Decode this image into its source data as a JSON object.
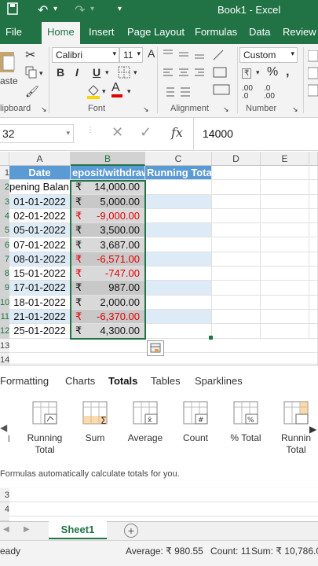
{
  "window": {
    "title": "Book1 - Excel"
  },
  "tabs": [
    "File",
    "Home",
    "Insert",
    "Page Layout",
    "Formulas",
    "Data",
    "Review"
  ],
  "ribbon": {
    "clipboard": {
      "paste_label": "aste",
      "group_label": "lipboard"
    },
    "font": {
      "name": "Calibri",
      "size": "11",
      "bold": "B",
      "italic": "I",
      "underline": "U",
      "grow": "A",
      "shrink": "A",
      "group_label": "Font"
    },
    "alignment": {
      "group_label": "Alignment"
    },
    "number": {
      "format": "Custom",
      "currency": "₹",
      "percent": "%",
      "comma": ",",
      "inc_dec": ".00\n.0",
      "dec_dec": ".0\n.00",
      "group_label": "Number"
    }
  },
  "formula_bar": {
    "name_box": "32",
    "fx": "fx",
    "value": "14000"
  },
  "columns": [
    "A",
    "B",
    "C",
    "D",
    "E"
  ],
  "row_numbers": [
    "1",
    "2",
    "3",
    "4",
    "5",
    "6",
    "7",
    "8",
    "9",
    "10",
    "11",
    "12",
    "13",
    "14"
  ],
  "table": {
    "headers": [
      "Date",
      "eposit/withdraw",
      "Running Total"
    ],
    "rows": [
      {
        "date": "pening Balan",
        "currency": "₹",
        "amount": "14,000.00",
        "negative": false
      },
      {
        "date": "01-01-2022",
        "currency": "₹",
        "amount": "5,000.00",
        "negative": false
      },
      {
        "date": "02-01-2022",
        "currency": "₹",
        "amount": "-9,000.00",
        "negative": true
      },
      {
        "date": "05-01-2022",
        "currency": "₹",
        "amount": "3,500.00",
        "negative": false
      },
      {
        "date": "07-01-2022",
        "currency": "₹",
        "amount": "3,687.00",
        "negative": false
      },
      {
        "date": "08-01-2022",
        "currency": "₹",
        "amount": "-6,571.00",
        "negative": true
      },
      {
        "date": "15-01-2022",
        "currency": "₹",
        "amount": "-747.00",
        "negative": true
      },
      {
        "date": "17-01-2022",
        "currency": "₹",
        "amount": "987.00",
        "negative": false
      },
      {
        "date": "18-01-2022",
        "currency": "₹",
        "amount": "2,000.00",
        "negative": false
      },
      {
        "date": "21-01-2022",
        "currency": "₹",
        "amount": "-6,370.00",
        "negative": true
      },
      {
        "date": "25-01-2022",
        "currency": "₹",
        "amount": "4,300.00",
        "negative": false
      }
    ]
  },
  "quick_analysis": {
    "tabs": [
      "Formatting",
      "Charts",
      "Totals",
      "Tables",
      "Sparklines"
    ],
    "active_tab": "Totals",
    "items": [
      {
        "label": "Running\nTotal",
        "icon": "running-total-column-icon"
      },
      {
        "label": "Sum",
        "icon": "sum-icon"
      },
      {
        "label": "Average",
        "icon": "average-icon"
      },
      {
        "label": "Count",
        "icon": "count-icon"
      },
      {
        "label": "% Total",
        "icon": "percent-total-icon"
      },
      {
        "label": "Runnin\nTotal",
        "icon": "running-total-row-icon"
      }
    ],
    "description": "Formulas automatically calculate totals for you."
  },
  "sheets": {
    "active": "Sheet1",
    "add": "+"
  },
  "status": {
    "mode": "eady",
    "average": "Average: ₹ 980.55",
    "count": "Count: 11",
    "sum": "Sum: ₹ 10,786.00"
  },
  "colors": {
    "brand": "#217346",
    "header_fill": "#5b9bd5",
    "band": "#ddebf7",
    "negative": "#e00000"
  }
}
